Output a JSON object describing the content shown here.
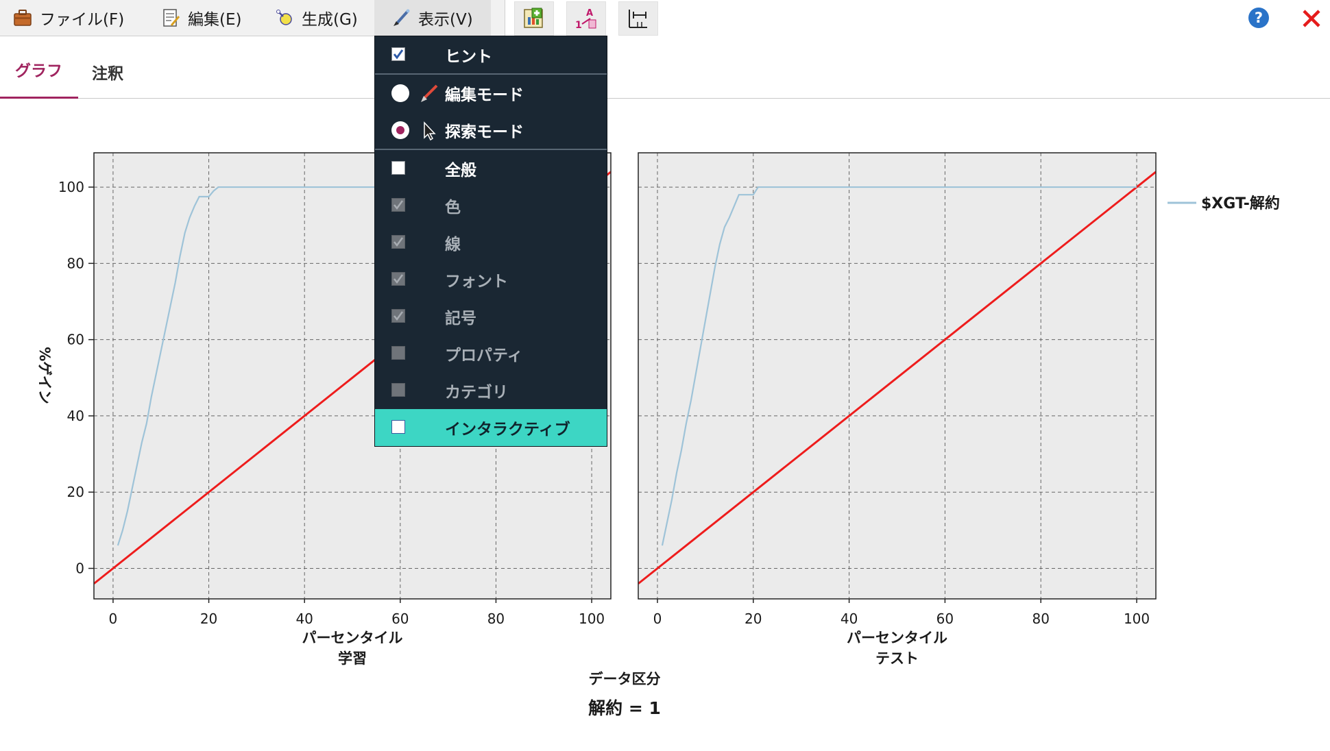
{
  "menubar": {
    "file_label": "ファイル(F)",
    "edit_label": "編集(E)",
    "generate_label": "生成(G)",
    "view_label": "表示(V)",
    "help_icon": "help-icon",
    "close_icon": "close-icon"
  },
  "tabs": [
    {
      "label": "グラフ",
      "active": true
    },
    {
      "label": "注釈",
      "active": false
    }
  ],
  "view_menu": {
    "items": [
      {
        "label": "ヒント",
        "kind": "checkbox",
        "checked": true,
        "enabled": true
      },
      {
        "label": "編集モード",
        "kind": "radio",
        "checked": false,
        "icon": "brush-icon"
      },
      {
        "label": "探索モード",
        "kind": "radio",
        "checked": true,
        "icon": "pointer-icon"
      },
      {
        "label": "全般",
        "kind": "checkbox",
        "checked": false,
        "enabled": true
      },
      {
        "label": "色",
        "kind": "checkbox",
        "checked": true,
        "enabled": false
      },
      {
        "label": "線",
        "kind": "checkbox",
        "checked": true,
        "enabled": false
      },
      {
        "label": "フォント",
        "kind": "checkbox",
        "checked": true,
        "enabled": false
      },
      {
        "label": "記号",
        "kind": "checkbox",
        "checked": true,
        "enabled": false
      },
      {
        "label": "プロパティ",
        "kind": "checkbox",
        "checked": false,
        "enabled": false
      },
      {
        "label": "カテゴリ",
        "kind": "checkbox",
        "checked": false,
        "enabled": false
      },
      {
        "label": "インタラクティブ",
        "kind": "checkbox",
        "checked": false,
        "enabled": true,
        "highlighted": true
      }
    ]
  },
  "colors": {
    "accent": "#a0245f",
    "menu_bg": "#1a2733",
    "menu_highlight": "#3dd6c4",
    "gain_line": "#9ec3d8",
    "baseline": "#ee1c1c",
    "plot_bg": "#ebebeb"
  },
  "chart_data": {
    "type": "line",
    "ylabel": "%ゲイン",
    "xlabel": "パーセンタイル",
    "facet_title": "データ区分",
    "footer": "解約 = 1",
    "xlim": [
      -4,
      104
    ],
    "ylim": [
      -8,
      109
    ],
    "xticks": [
      0,
      20,
      40,
      60,
      80,
      100
    ],
    "yticks": [
      0,
      20,
      40,
      60,
      80,
      100
    ],
    "grid": true,
    "legend": {
      "position": "right",
      "entries": [
        "$XGT-解約"
      ]
    },
    "panels": [
      {
        "name": "学習",
        "series": [
          {
            "name": "$XGT-解約",
            "color": "#9ec3d8",
            "x": [
              1,
              2,
              3,
              4,
              5,
              6,
              7,
              8,
              9,
              10,
              11,
              12,
              13,
              14,
              15,
              16,
              17,
              18,
              19,
              20,
              21,
              22,
              40,
              60,
              80,
              100
            ],
            "y": [
              6,
              10,
              15,
              21,
              27,
              33,
              38,
              45,
              51,
              57,
              63,
              69,
              75,
              82,
              88,
              92,
              95,
              97.5,
              97.5,
              97.5,
              99,
              100,
              100,
              100,
              100,
              100
            ]
          }
        ],
        "baseline": {
          "x": [
            -4,
            104
          ],
          "y": [
            -4,
            104
          ]
        }
      },
      {
        "name": "テスト",
        "series": [
          {
            "name": "$XGT-解約",
            "color": "#9ec3d8",
            "x": [
              1,
              2,
              3,
              4,
              5,
              6,
              7,
              8,
              9,
              10,
              11,
              12,
              13,
              14,
              15,
              16,
              17,
              18,
              19,
              20,
              21,
              40,
              60,
              80,
              100
            ],
            "y": [
              6,
              12,
              18,
              25,
              31,
              38,
              44,
              51,
              58,
              65,
              72,
              79,
              85,
              89.5,
              92,
              95,
              98,
              98,
              98,
              98,
              100,
              100,
              100,
              100,
              100
            ]
          }
        ],
        "baseline": {
          "x": [
            -4,
            104
          ],
          "y": [
            -4,
            104
          ]
        }
      }
    ]
  }
}
